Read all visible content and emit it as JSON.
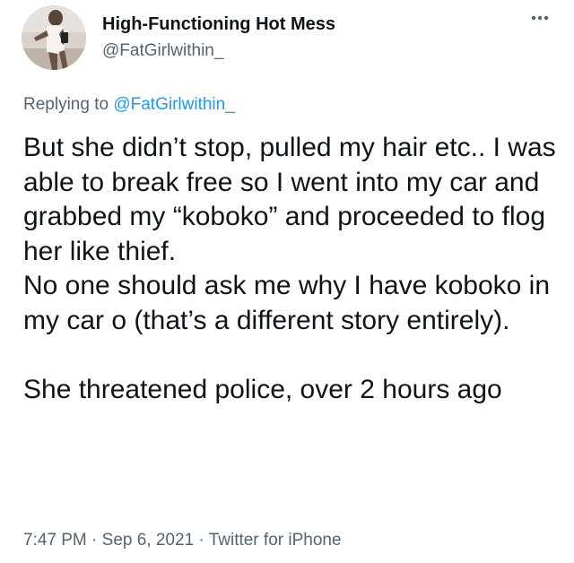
{
  "author": {
    "display_name": "High-Functioning Hot Mess",
    "handle": "@FatGirlwithin_"
  },
  "more_icon": "more-horizontal-icon",
  "reply": {
    "prefix": "Replying to",
    "mention": "@FatGirlwithin_"
  },
  "tweet": {
    "paragraphs": [
      "But she didn’t stop, pulled my hair etc.. I was able to break free so I went into my car and grabbed my “koboko” and proceeded to flog her like thief.\nNo one should ask me why I have koboko in my car o (that’s a different story entirely).",
      "She threatened police, over 2 hours ago"
    ]
  },
  "meta": {
    "time": "7:47 PM",
    "date": "Sep 6, 2021",
    "separator": "·",
    "source": "Twitter for iPhone"
  },
  "colors": {
    "text_primary": "#0f1419",
    "text_secondary": "#536471",
    "link": "#1d9bf0",
    "background": "#ffffff"
  }
}
